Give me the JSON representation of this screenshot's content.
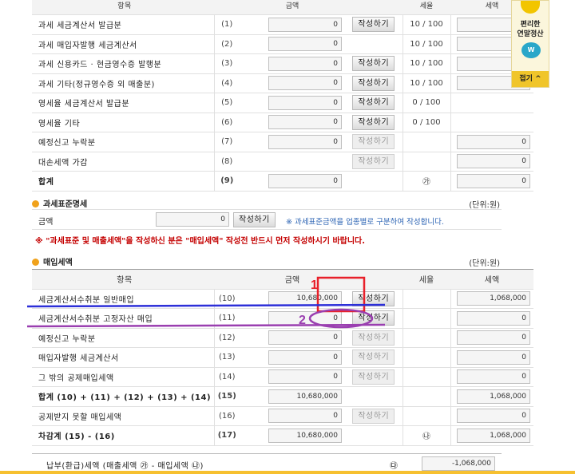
{
  "sales_table": {
    "header": [
      "항목",
      "금액",
      "세율",
      "세액"
    ],
    "rows": [
      {
        "label": "과세 세금계산서 발급분",
        "no": "(1)",
        "amount": "0",
        "button": "작성하기",
        "btn_active": true,
        "rate": "10 / 100",
        "tax": "0",
        "bold": false
      },
      {
        "label": "과세 매입자발행 세금계산서",
        "no": "(2)",
        "amount": "0",
        "button": "",
        "btn_active": false,
        "rate": "10 / 100",
        "tax": "0",
        "bold": false
      },
      {
        "label": "과세 신용카드 · 현금영수증 발행분",
        "no": "(3)",
        "amount": "0",
        "button": "작성하기",
        "btn_active": true,
        "rate": "10 / 100",
        "tax": "0",
        "bold": false
      },
      {
        "label": "과세 기타(정규영수증 외 매출분)",
        "no": "(4)",
        "amount": "0",
        "button": "작성하기",
        "btn_active": true,
        "rate": "10 / 100",
        "tax": "0",
        "bold": false
      },
      {
        "label": "영세율 세금계산서 발급분",
        "no": "(5)",
        "amount": "0",
        "button": "작성하기",
        "btn_active": true,
        "rate": "0 / 100",
        "tax": "",
        "bold": false
      },
      {
        "label": "영세율 기타",
        "no": "(6)",
        "amount": "0",
        "button": "작성하기",
        "btn_active": true,
        "rate": "0 / 100",
        "tax": "",
        "bold": false
      },
      {
        "label": "예정신고 누락분",
        "no": "(7)",
        "amount": "0",
        "button": "작성하기",
        "btn_active": false,
        "rate": "",
        "tax": "0",
        "bold": false
      },
      {
        "label": "대손세액 가감",
        "no": "(8)",
        "amount": "",
        "button": "작성하기",
        "btn_active": false,
        "rate": "",
        "tax": "0",
        "bold": false
      },
      {
        "label": "합계",
        "no": "(9)",
        "amount": "0",
        "button": "",
        "btn_active": false,
        "rate": "㉮",
        "tax": "0",
        "bold": true
      }
    ]
  },
  "tax_base": {
    "title": "과세표준명세",
    "unit": "(단위:원)",
    "label": "금액",
    "amount": "0",
    "button": "작성하기",
    "note": "※ 과세표준금액을 업종별로 구분하여 작성합니다."
  },
  "warning": "※ \"과세표준 및 매출세액\"을 작성하신 분은 \"매입세액\" 작성전 반드시 먼저 작성하시기 바랍니다.",
  "purchase": {
    "title": "매입세액",
    "unit": "(단위:원)",
    "header": [
      "항목",
      "금액",
      "세율",
      "세액"
    ],
    "rows": [
      {
        "label": "세금계산서수취분 일반매입",
        "no": "(10)",
        "amount": "10,680,000",
        "button": "작성하기",
        "btn_active": true,
        "tax": "1,068,000",
        "bold": false
      },
      {
        "label": "세금계산서수취분 고정자산 매입",
        "no": "(11)",
        "amount": "0",
        "button": "작성하기",
        "btn_active": true,
        "tax": "0",
        "bold": false
      },
      {
        "label": "예정신고 누락분",
        "no": "(12)",
        "amount": "0",
        "button": "작성하기",
        "btn_active": false,
        "tax": "0",
        "bold": false
      },
      {
        "label": "매입자발행 세금계산서",
        "no": "(13)",
        "amount": "0",
        "button": "작성하기",
        "btn_active": false,
        "tax": "0",
        "bold": false
      },
      {
        "label": "그 밖의 공제매입세액",
        "no": "(14)",
        "amount": "0",
        "button": "작성하기",
        "btn_active": false,
        "tax": "0",
        "bold": false
      },
      {
        "label": "합계 (10) + (11) + (12) + (13) + (14)",
        "no": "(15)",
        "amount": "10,680,000",
        "button": "",
        "btn_active": false,
        "tax": "1,068,000",
        "bold": true
      },
      {
        "label": "공제받지 못할 매입세액",
        "no": "(16)",
        "amount": "0",
        "button": "작성하기",
        "btn_active": false,
        "tax": "0",
        "bold": false
      },
      {
        "label": "차감계 (15) - (16)",
        "no": "(17)",
        "amount": "10,680,000",
        "button": "",
        "btn_active": false,
        "rate": "㉯",
        "tax": "1,068,000",
        "bold": true
      }
    ]
  },
  "payable": {
    "label": "납부(환급)세액 (매출세액 ㉮ - 매입세액 ㉯)",
    "mark": "㉰",
    "tax": "-1,068,000"
  },
  "annotations": {
    "marker1": "1",
    "marker2": "2",
    "red_color": "#e8202a",
    "blue_color": "#2d2fd8",
    "purple_color": "#9a3fb0"
  },
  "sidebar": {
    "line1": "편리한",
    "line2": "연말정산",
    "fold_label": "접기"
  }
}
